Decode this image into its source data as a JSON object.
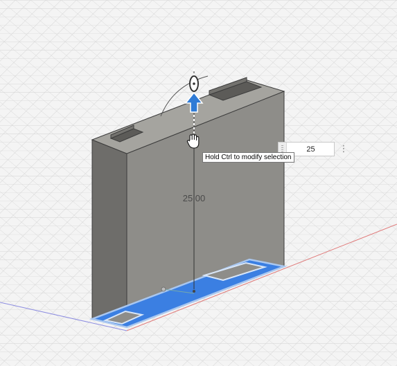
{
  "viewport": {
    "dimension_label": "25.00"
  },
  "dimension_input": {
    "value": "25",
    "menu_glyph": "⋮"
  },
  "tooltip": {
    "text": "Hold Ctrl to modify selection"
  },
  "colors": {
    "background": "#f4f4f4",
    "grid_line": "#c9c9c9",
    "body_front": "#8d8c88",
    "body_side": "#6d6c69",
    "body_top": "#a6a5a1",
    "selection_blue": "#3a7de0",
    "arrow_blue": "#2f7bd6",
    "x_axis": "#e07b7b",
    "y_axis": "#8c8ce0"
  },
  "icons": [
    "move-arrow-icon",
    "rotate-handle-icon",
    "hand-cursor-icon",
    "kebab-menu-icon"
  ]
}
